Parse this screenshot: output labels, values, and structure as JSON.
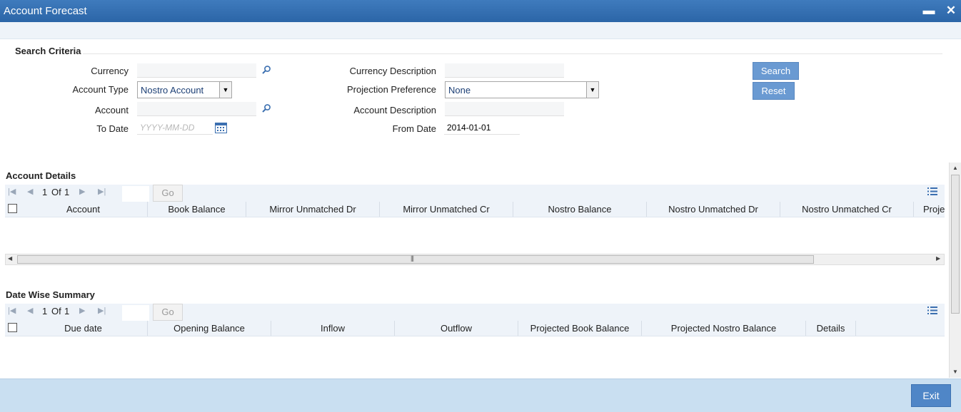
{
  "window": {
    "title": "Account Forecast",
    "minimize": "▬",
    "close": "✕"
  },
  "search_criteria": {
    "title": "Search Criteria",
    "currency": {
      "label": "Currency",
      "value": ""
    },
    "currency_description": {
      "label": "Currency Description",
      "value": ""
    },
    "account_type": {
      "label": "Account Type",
      "value": "Nostro Account"
    },
    "projection_preference": {
      "label": "Projection Preference",
      "value": "None"
    },
    "account": {
      "label": "Account",
      "value": ""
    },
    "account_description": {
      "label": "Account Description",
      "value": ""
    },
    "to_date": {
      "label": "To Date",
      "value": "",
      "placeholder": "YYYY-MM-DD"
    },
    "from_date": {
      "label": "From Date",
      "value": "2014-01-01"
    },
    "search_label": "Search",
    "reset_label": "Reset"
  },
  "account_details": {
    "title": "Account Details",
    "pager": {
      "current": "1",
      "of": "Of",
      "total": "1",
      "go_label": "Go"
    },
    "columns": [
      "Account",
      "Book Balance",
      "Mirror Unmatched Dr",
      "Mirror Unmatched Cr",
      "Nostro Balance",
      "Nostro Unmatched Dr",
      "Nostro Unmatched Cr",
      "Proje"
    ]
  },
  "date_wise_summary": {
    "title": "Date Wise Summary",
    "pager": {
      "current": "1",
      "of": "Of",
      "total": "1",
      "go_label": "Go"
    },
    "columns": [
      "Due date",
      "Opening Balance",
      "Inflow",
      "Outflow",
      "Projected Book Balance",
      "Projected Nostro Balance",
      "Details"
    ]
  },
  "footer": {
    "exit_label": "Exit"
  },
  "colors": {
    "title_bar": "#2b65a7",
    "button": "#6a9ad2",
    "footer": "#c9dff1",
    "grid_header": "#eef3f9"
  }
}
